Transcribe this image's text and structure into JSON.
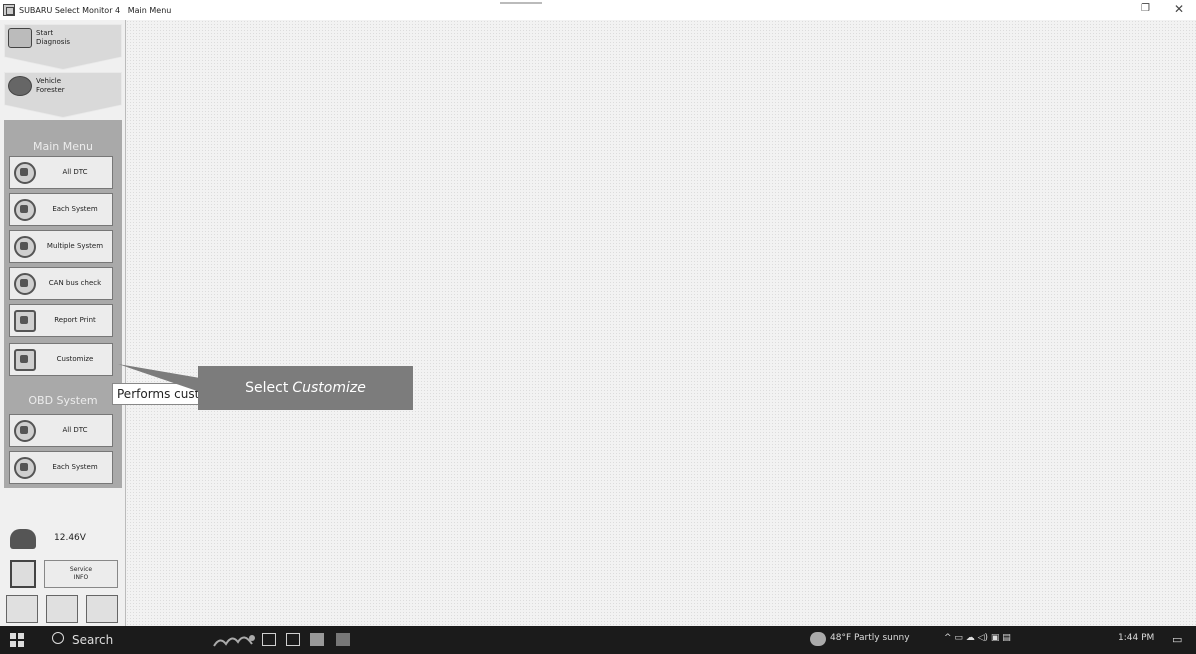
{
  "window": {
    "title": "SUBARU Select Monitor 4   Main Menu",
    "restore_glyph": "❐",
    "close_glyph": "✕"
  },
  "sidebar": {
    "start_diagnosis": "Start\nDiagnosis",
    "vehicle": "Vehicle\nForester",
    "main_menu": {
      "title": "Main Menu",
      "items": [
        {
          "label": "All DTC",
          "icon": "magnifier-icon"
        },
        {
          "label": "Each System",
          "icon": "system-icon"
        },
        {
          "label": "Multiple System",
          "icon": "multi-system-icon"
        },
        {
          "label": "CAN bus check",
          "icon": "can-bus-icon"
        },
        {
          "label": "Report Print",
          "icon": "report-icon"
        },
        {
          "label": "Customize",
          "icon": "customize-icon"
        }
      ]
    },
    "obd_system": {
      "title": "OBD System",
      "items": [
        {
          "label": "All DTC",
          "icon": "magnifier-icon"
        },
        {
          "label": "Each System",
          "icon": "system-icon"
        }
      ]
    },
    "voltage": "12.46V",
    "service_info": "Service\nINFO"
  },
  "tooltip": {
    "text": "Performs customize"
  },
  "callout": {
    "prefix": "Select",
    "emphasis": "Customize"
  },
  "taskbar": {
    "search": "Search",
    "weather": "48°F  Partly sunny",
    "tray_icons": "^  ▭  ☁  ◁)  ▣  ▤",
    "time": "1:44 PM",
    "notification_glyph": "▭"
  },
  "colors": {
    "sidebar_panel": "#a9a9a9",
    "callout": "#7c7c7c",
    "taskbar": "#1b1b1b"
  }
}
